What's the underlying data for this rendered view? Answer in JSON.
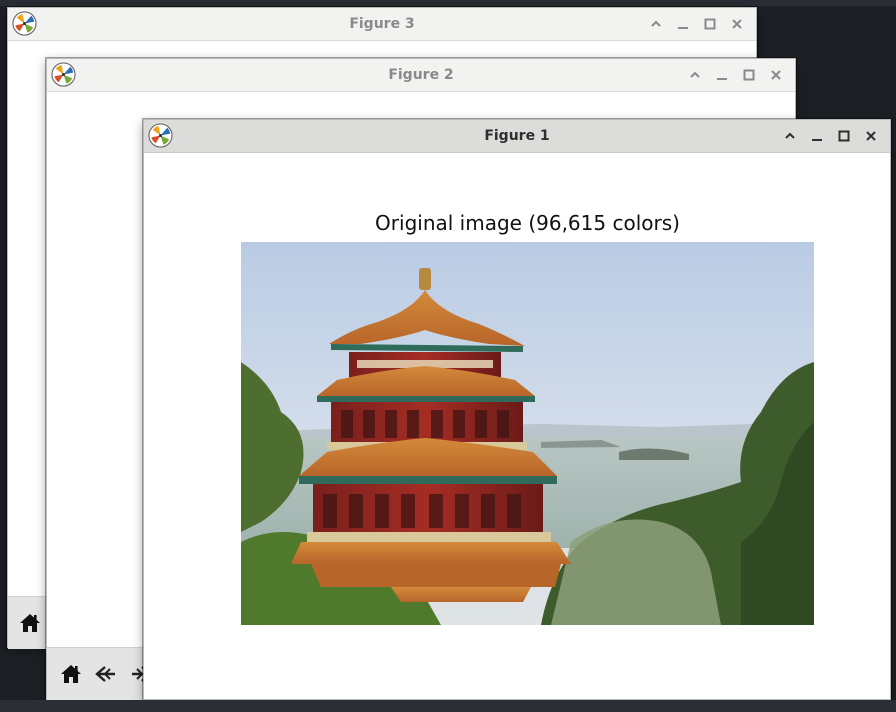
{
  "figure3": {
    "title": "Figure 3"
  },
  "figure2": {
    "title": "Figure 2"
  },
  "figure1": {
    "title": "Figure 1",
    "axes_title": "Original image (96,615 colors)"
  },
  "icons": {
    "app": "matplotlib-logo-icon",
    "collapse": "caret-up-icon",
    "minimize": "minimize-icon",
    "maximize": "maximize-icon",
    "close": "close-icon",
    "home": "home-icon",
    "back": "back-arrow-icon",
    "forward": "forward-arrow-icon"
  }
}
